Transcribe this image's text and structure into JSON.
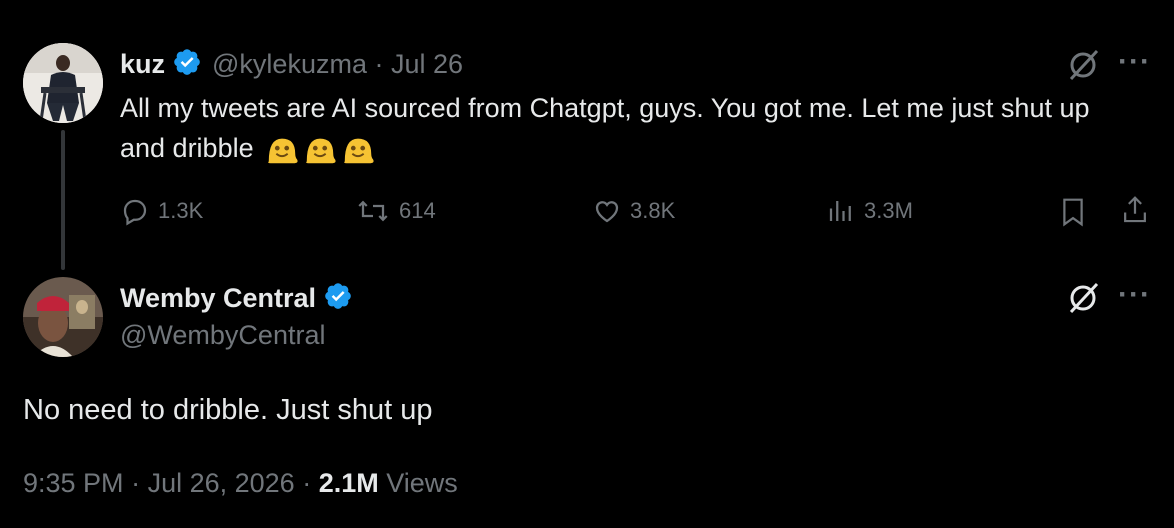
{
  "tweet1": {
    "name": "kuz",
    "handle": "@kylekuzma",
    "separator": " · ",
    "date": "Jul 26",
    "text": "All my tweets are AI sourced from Chatgpt, guys. You got me. Let me just shut up and dribble",
    "emojis": [
      "melting-face",
      "melting-face",
      "melting-face"
    ],
    "replies": "1.3K",
    "reposts": "614",
    "likes": "3.8K",
    "views": "3.3M",
    "more": "···"
  },
  "tweet2": {
    "name": "Wemby Central",
    "handle": "@WembyCentral",
    "text": "No need to dribble. Just shut up",
    "time": "9:35 PM",
    "date": "Jul 26, 2026",
    "separator": " · ",
    "views_count": "2.1M",
    "views_label": " Views",
    "more": "···"
  },
  "colors": {
    "background": "#000000",
    "text": "#e7e9ea",
    "muted": "#71767b",
    "verified": "#1d9bf0",
    "thread_line": "#333639"
  },
  "icons": {
    "verified": "verified-badge-icon",
    "grok": "grok-icon",
    "reply": "reply-icon",
    "repost": "repost-icon",
    "like": "like-icon",
    "views": "views-icon",
    "bookmark": "bookmark-icon",
    "share": "share-icon",
    "more": "more-icon"
  }
}
